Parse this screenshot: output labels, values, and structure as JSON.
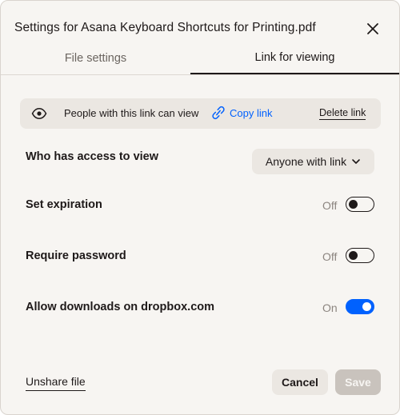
{
  "dialog": {
    "title": "Settings for Asana Keyboard Shortcuts for Printing.pdf",
    "close_icon": "close-icon"
  },
  "tabs": [
    {
      "label": "File settings",
      "active": false
    },
    {
      "label": "Link for viewing",
      "active": true
    }
  ],
  "link_banner": {
    "icon": "eye-icon",
    "text": "People with this link can view",
    "copy_icon": "chain-link-icon",
    "copy_label": "Copy link",
    "delete_label": "Delete link"
  },
  "access": {
    "label": "Who has access to view",
    "selected": "Anyone with link"
  },
  "settings": [
    {
      "label": "Set expiration",
      "state": "Off",
      "enabled": false
    },
    {
      "label": "Require password",
      "state": "Off",
      "enabled": false
    },
    {
      "label": "Allow downloads on dropbox.com",
      "state": "On",
      "enabled": true
    }
  ],
  "footer": {
    "unshare_label": "Unshare file",
    "cancel_label": "Cancel",
    "save_label": "Save"
  },
  "colors": {
    "accent": "#0061fe",
    "background": "#f7f5f2",
    "chip": "#ebe7e2",
    "disabled_button": "#c9c3bd"
  }
}
